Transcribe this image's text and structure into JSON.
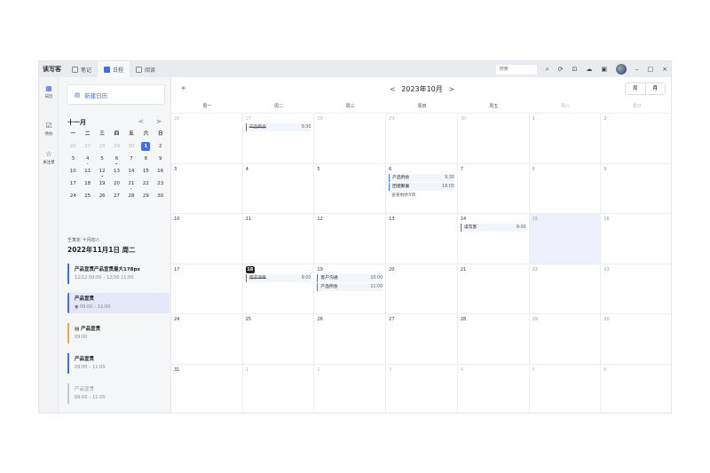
{
  "app": {
    "title": "读写客"
  },
  "tabs": [
    {
      "label": "笔记",
      "active": false
    },
    {
      "label": "日程",
      "active": true
    },
    {
      "label": "阅读",
      "active": false
    }
  ],
  "toolbar": {
    "search_placeholder": "搜索"
  },
  "rail": [
    {
      "label": "日历",
      "icon": "calendar-icon",
      "active": true
    },
    {
      "label": "待办",
      "icon": "checkbox-icon",
      "active": false
    },
    {
      "label": "关注星",
      "icon": "star-icon",
      "active": false
    }
  ],
  "sidebar": {
    "new_calendar": "新建日历",
    "mini_month": "十一月",
    "mini_nav_prev": "<",
    "mini_nav_next": ">",
    "weekdays": [
      "一",
      "二",
      "三",
      "四",
      "五",
      "六",
      "日"
    ],
    "days": [
      {
        "d": "26",
        "dim": true
      },
      {
        "d": "27",
        "dim": true
      },
      {
        "d": "28",
        "dim": true
      },
      {
        "d": "29",
        "dim": true
      },
      {
        "d": "30",
        "dim": true
      },
      {
        "d": "1",
        "selected": true
      },
      {
        "d": "2"
      },
      {
        "d": "3"
      },
      {
        "d": "4",
        "dot": true
      },
      {
        "d": "5"
      },
      {
        "d": "6",
        "dot": true
      },
      {
        "d": "7"
      },
      {
        "d": "8"
      },
      {
        "d": "9"
      },
      {
        "d": "10"
      },
      {
        "d": "11"
      },
      {
        "d": "12",
        "dot": true
      },
      {
        "d": "13"
      },
      {
        "d": "14"
      },
      {
        "d": "15"
      },
      {
        "d": "16"
      },
      {
        "d": "17"
      },
      {
        "d": "18"
      },
      {
        "d": "19"
      },
      {
        "d": "20"
      },
      {
        "d": "21",
        "dot": true
      },
      {
        "d": "22"
      },
      {
        "d": "23"
      },
      {
        "d": "24"
      },
      {
        "d": "25"
      },
      {
        "d": "26"
      },
      {
        "d": "27"
      },
      {
        "d": "28"
      },
      {
        "d": "29"
      },
      {
        "d": "30"
      }
    ],
    "lunar": "壬寅年 十月初八",
    "selected_date": "2022年11月1日 周二",
    "events": [
      {
        "title": "产品宣贯产品宣贯最大178px",
        "time": "12/12 09:00 – 12/30 11:00",
        "style": "blue",
        "selected": false
      },
      {
        "title": "产品宣贯",
        "time": "● 09:00 – 11:00",
        "style": "blue",
        "selected": true
      },
      {
        "title": "▤ 产品宣贯",
        "time": "09:00",
        "style": "orange",
        "selected": false
      },
      {
        "title": "产品宣贯",
        "time": "09:00 – 11:00",
        "style": "blue",
        "selected": false
      },
      {
        "title": "产品宣贯",
        "time": "09:00 – 11:00",
        "style": "grey",
        "selected": false
      }
    ]
  },
  "calendar": {
    "title": "2023年10月",
    "prev": "<",
    "next": ">",
    "view_week": "周",
    "view_month": "月",
    "weekdays": [
      "周一",
      "周二",
      "周三",
      "周四",
      "周五",
      "周六",
      "周日"
    ],
    "weeks": [
      [
        {
          "d": "26",
          "dim": true
        },
        {
          "d": "27",
          "dim": true,
          "events": [
            {
              "t": "产品例会",
              "time": "9:30",
              "done": true
            }
          ]
        },
        {
          "d": "28",
          "dim": true
        },
        {
          "d": "29",
          "dim": true
        },
        {
          "d": "30",
          "dim": true
        },
        {
          "d": "1"
        },
        {
          "d": "2"
        }
      ],
      [
        {
          "d": "3"
        },
        {
          "d": "4"
        },
        {
          "d": "5"
        },
        {
          "d": "6",
          "events": [
            {
              "t": "产品例会",
              "time": "9:30"
            },
            {
              "t": "团建聚餐",
              "time": "18:00"
            }
          ],
          "more": "查看剩余5项"
        },
        {
          "d": "7"
        },
        {
          "d": "8"
        },
        {
          "d": "9"
        }
      ],
      [
        {
          "d": "10"
        },
        {
          "d": "11"
        },
        {
          "d": "12"
        },
        {
          "d": "13"
        },
        {
          "d": "14",
          "events": [
            {
              "t": "读写客",
              "time": "9:00"
            }
          ]
        },
        {
          "d": "15",
          "highlight": true
        },
        {
          "d": "16"
        }
      ],
      [
        {
          "d": "17"
        },
        {
          "d": "18",
          "today": true,
          "events": [
            {
              "t": "需求评审",
              "time": "9:00",
              "done": true
            }
          ]
        },
        {
          "d": "19",
          "events": [
            {
              "t": "客户沟通",
              "time": "10:00"
            },
            {
              "t": "产品例会",
              "time": "11:00"
            }
          ]
        },
        {
          "d": "20"
        },
        {
          "d": "21"
        },
        {
          "d": "22"
        },
        {
          "d": "23"
        }
      ],
      [
        {
          "d": "24"
        },
        {
          "d": "25"
        },
        {
          "d": "26"
        },
        {
          "d": "27"
        },
        {
          "d": "28"
        },
        {
          "d": "29"
        },
        {
          "d": "30"
        }
      ],
      [
        {
          "d": "31"
        },
        {
          "d": "1",
          "dim": true
        },
        {
          "d": "2",
          "dim": true
        },
        {
          "d": "3",
          "dim": true
        },
        {
          "d": "4",
          "dim": true
        },
        {
          "d": "5",
          "dim": true
        },
        {
          "d": "6",
          "dim": true
        }
      ]
    ]
  }
}
